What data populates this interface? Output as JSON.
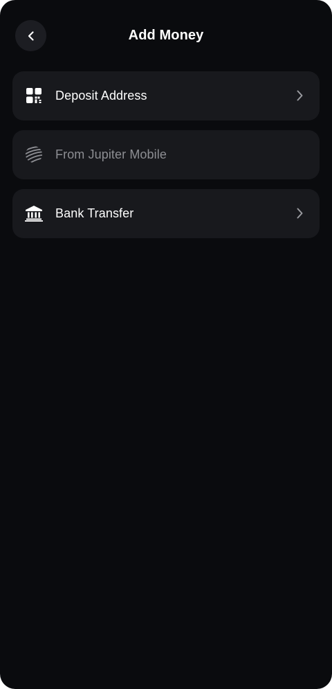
{
  "header": {
    "title": "Add Money",
    "back_icon": "chevron-left-icon"
  },
  "menu": {
    "items": [
      {
        "label": "Deposit Address",
        "icon": "qr-code-icon",
        "enabled": true,
        "trailing_icon": "chevron-right-icon"
      },
      {
        "label": "From Jupiter Mobile",
        "icon": "jupiter-logo-icon",
        "enabled": false
      },
      {
        "label": "Bank Transfer",
        "icon": "bank-icon",
        "enabled": true,
        "trailing_icon": "chevron-right-icon"
      }
    ]
  },
  "colors": {
    "background": "#0a0b0e",
    "card": "#18191d",
    "back_button": "#1c1d22",
    "text_primary": "#ffffff",
    "text_disabled": "#8d8e93",
    "chevron": "#9a9ba0"
  }
}
